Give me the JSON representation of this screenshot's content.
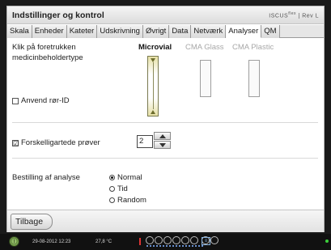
{
  "window": {
    "title": "Indstillinger og kontrol",
    "brand": "ISCUS",
    "brand_sup": "flex",
    "brand_tail": "| Rev L"
  },
  "tabs": [
    {
      "label": "Skala",
      "active": false
    },
    {
      "label": "Enheder",
      "active": false
    },
    {
      "label": "Kateter",
      "active": false
    },
    {
      "label": "Udskrivning",
      "active": false
    },
    {
      "label": "Øvrigt",
      "active": false
    },
    {
      "label": "Data",
      "active": false
    },
    {
      "label": "Netværk",
      "active": false
    },
    {
      "label": "Analyser",
      "active": true
    },
    {
      "label": "QM",
      "active": false
    }
  ],
  "vial_section": {
    "label_line1": "Klik på foretrukken",
    "label_line2": "medicinbeholdertype",
    "options": [
      {
        "label": "Microvial",
        "selected": true
      },
      {
        "label": "CMA Glass",
        "selected": false
      },
      {
        "label": "CMA Plastic",
        "selected": false
      }
    ],
    "tube_id_checkbox": {
      "label": "Anvend rør-ID",
      "checked": false
    }
  },
  "samples_section": {
    "checkbox_label": "Forskelligartede prøver",
    "checkbox_glyph": "☑",
    "checked": true,
    "stepper_value": "2"
  },
  "order_section": {
    "label": "Bestilling af analyse",
    "options": [
      {
        "label": "Normal",
        "selected": true
      },
      {
        "label": "Tid",
        "selected": false
      },
      {
        "label": "Random",
        "selected": false
      }
    ]
  },
  "footer": {
    "back_label": "Tilbage"
  },
  "status_bar": {
    "power_glyph": "Ⓘ",
    "datetime": "29-08-2012 12:23",
    "temperature": "27,8 °C",
    "net_icon": "≡",
    "colors": {
      "power": "#6fa33c",
      "thermometer": "#dd3333",
      "led": "#3ccf3c"
    }
  }
}
